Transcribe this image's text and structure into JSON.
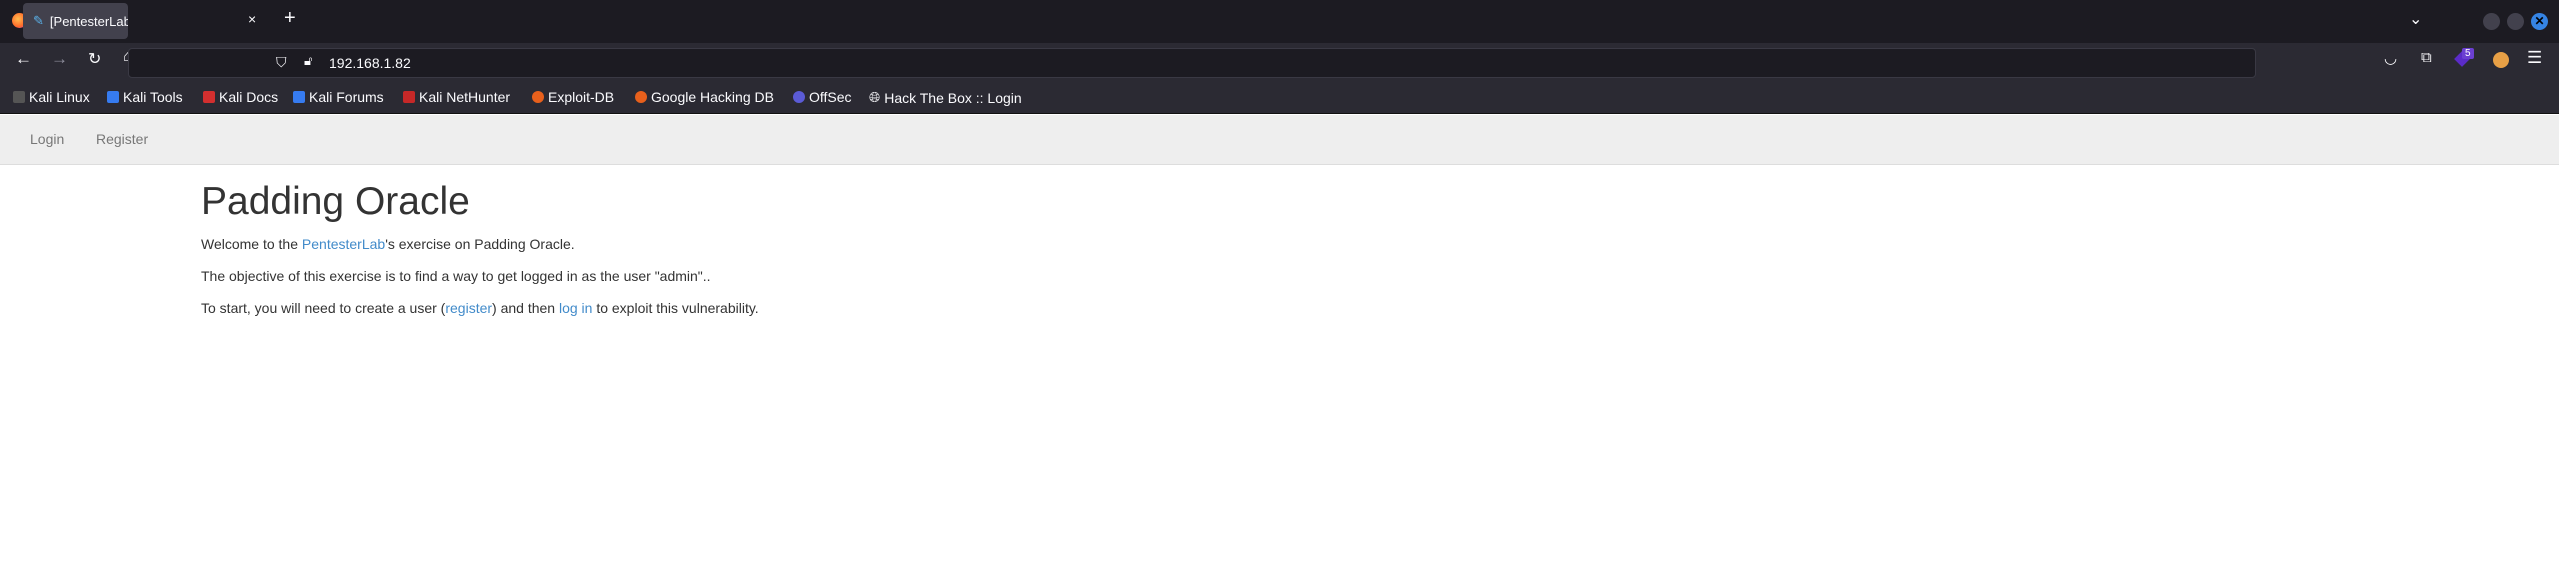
{
  "browser": {
    "tab_title": "[PentesterLab] Padding O",
    "url": "192.168.1.82",
    "extension_badge": "5",
    "bookmarks": [
      "Kali Linux",
      "Kali Tools",
      "Kali Docs",
      "Kali Forums",
      "Kali NetHunter",
      "Exploit-DB",
      "Google Hacking DB",
      "OffSec",
      "Hack The Box :: Login"
    ]
  },
  "nav": {
    "login": "Login",
    "register": "Register"
  },
  "page": {
    "title": "Padding Oracle",
    "p1_before": "Welcome to the ",
    "p1_link": "PentesterLab",
    "p1_after": "'s exercise on Padding Oracle.",
    "p2": "The objective of this exercise is to find a way to get logged in as the user \"admin\"..",
    "p3_a": "To start, you will need to create a user (",
    "p3_link1": "register",
    "p3_b": ") and then ",
    "p3_link2": "log in",
    "p3_c": " to exploit this vulnerability."
  }
}
